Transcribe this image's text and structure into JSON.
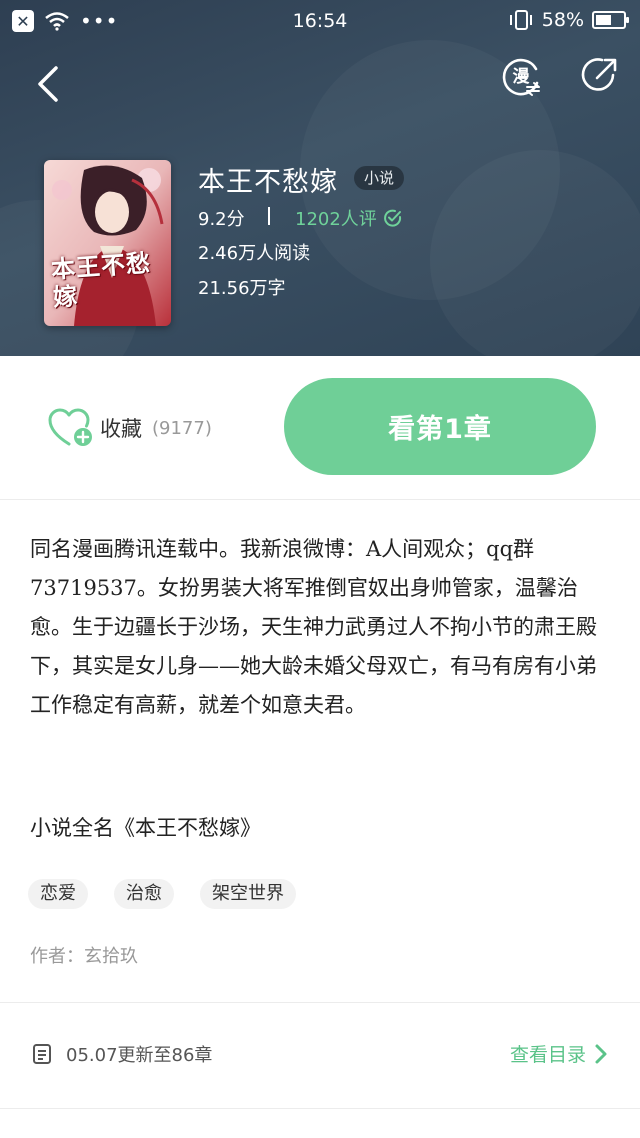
{
  "status_bar": {
    "close_glyph": "✕",
    "dots": "•••",
    "time": "16:54",
    "battery": "58%",
    "battery_level": 0.58
  },
  "book": {
    "title": "本王不愁嫁",
    "type_badge": "小说",
    "score": "9.2分",
    "reviews": "1202人评",
    "reads": "2.46万人阅读",
    "words": "21.56万字",
    "cover_title": "本王不愁嫁"
  },
  "actions": {
    "favorite_label": "收藏",
    "favorite_count": "(9177)",
    "read_button": "看第1章"
  },
  "description": "同名漫画腾讯连载中。我新浪微博：A人间观众；qq群73719537。女扮男装大将军推倒官奴出身帅管家，温馨治愈。生于边疆长于沙场，天生神力武勇过人不拘小节的肃王殿下，其实是女儿身——她大龄未婚父母双亡，有马有房有小弟工作稳定有高薪，就差个如意夫君。",
  "full_name": "小说全名《本王不愁嫁》",
  "tags": [
    "恋爱",
    "治愈",
    "架空世界"
  ],
  "author": "作者：玄拾玖",
  "update": {
    "text": "05.07更新至86章",
    "toc_label": "查看目录"
  },
  "colors": {
    "accent": "#6fcf97",
    "header_bg": "#34485b"
  },
  "icons": {
    "back": "back-arrow-icon",
    "manga": "manga-switch-icon",
    "share": "share-icon",
    "favorite": "heart-plus-icon",
    "verify": "check-circle-icon",
    "chapter_list": "document-icon",
    "chevron": "chevron-right-icon"
  }
}
